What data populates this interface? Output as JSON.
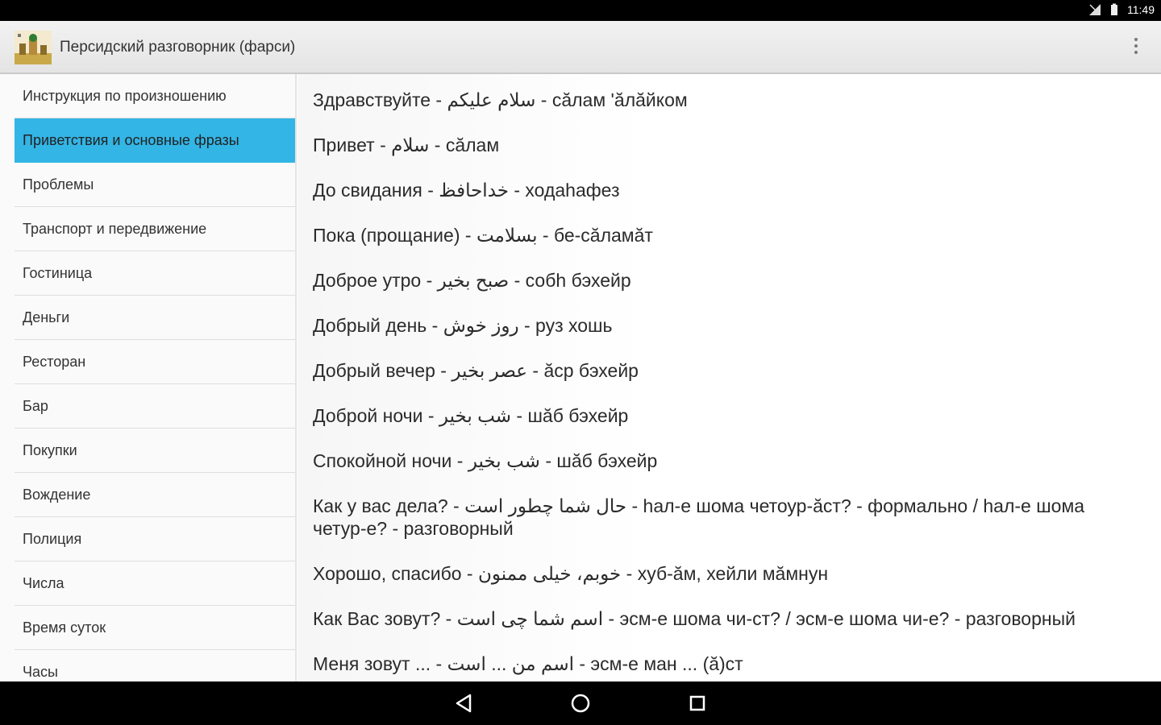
{
  "status_bar": {
    "time": "11:49",
    "icons": [
      "signal-icon",
      "battery-icon"
    ]
  },
  "app_bar": {
    "title": "Персидский разговорник (фарси)",
    "icon": "app-logo-icon",
    "overflow_icon": "overflow-menu-icon"
  },
  "sidebar": {
    "selected_index": 1,
    "accent_color": "#33b5e5",
    "items": [
      {
        "label": "Инструкция по произношению"
      },
      {
        "label": "Приветствия и основные фразы"
      },
      {
        "label": "Проблемы"
      },
      {
        "label": "Транспорт и передвижение"
      },
      {
        "label": "Гостиница"
      },
      {
        "label": "Деньги"
      },
      {
        "label": "Ресторан"
      },
      {
        "label": "Бар"
      },
      {
        "label": "Покупки"
      },
      {
        "label": "Вождение"
      },
      {
        "label": "Полиция"
      },
      {
        "label": "Числа"
      },
      {
        "label": "Время суток"
      },
      {
        "label": "Часы"
      }
    ]
  },
  "phrases": [
    {
      "text": "Здравствуйте - سلام علیکم - сӑлам 'ӑлӑйком"
    },
    {
      "text": "Привет - سلام - сӑлам"
    },
    {
      "text": "До свидания - خداحافظ - ходаһафез"
    },
    {
      "text": "Пока (прощание) - بسلامت - бе-сӑламӑт"
    },
    {
      "text": "Доброе утро - صبح بخیر - собһ бэхейр"
    },
    {
      "text": "Добрый день - روز خوش - руз хошь"
    },
    {
      "text": "Добрый вечер - عصر بخیر - ӑср бэхейр"
    },
    {
      "text": "Доброй ночи - شب بخیر - шӑб бэхейр"
    },
    {
      "text": "Спокойной ночи - شب بخیر - шӑб бэхейр"
    },
    {
      "text": "Как у вас дела? - حال شما چطور است - һал-е шома четоур-ӑст? - формально / һал-е шома четур-е? - разговорный"
    },
    {
      "text": "Хорошо, спасибо - خوبم، خیلی ممنون - хуб-ӑм, хейли мӑмнун"
    },
    {
      "text": "Как Вас зовут? - اسم شما چی است - эсм-е шома чи-ст? / эсм-е шома чи-е? - разговорный"
    },
    {
      "text": "Меня зовут ... - اسم من ... است - эсм-е ман ... (ӑ)ст"
    }
  ],
  "nav_bar": {
    "buttons": [
      "back-icon",
      "home-icon",
      "recents-icon"
    ]
  }
}
